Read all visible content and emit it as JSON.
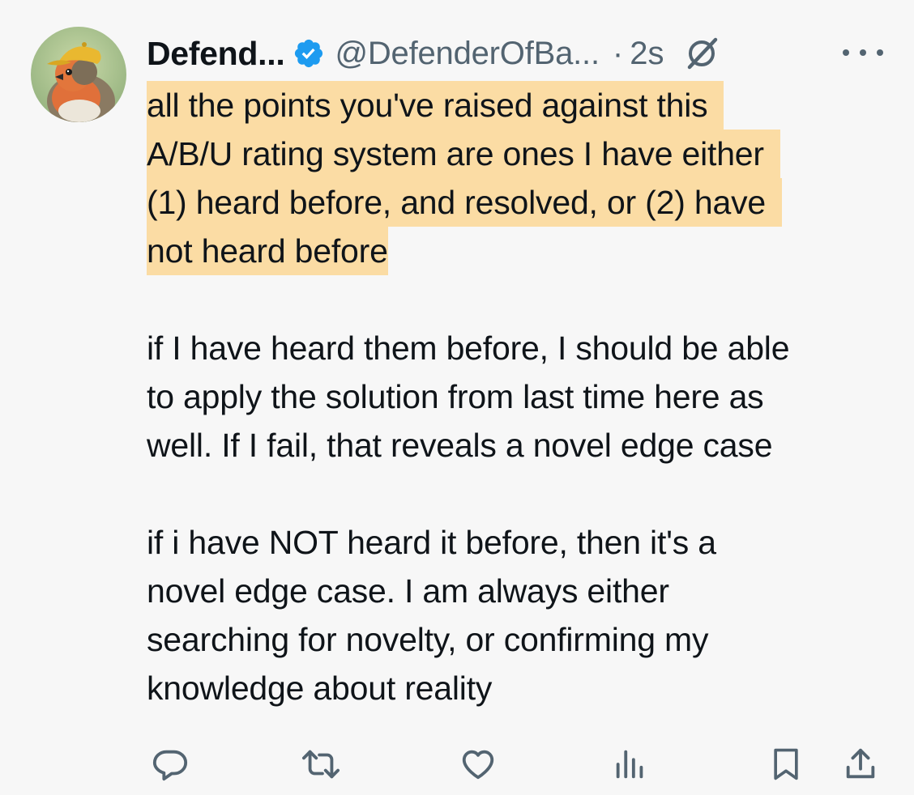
{
  "tweet": {
    "author": {
      "display_name": "Defend...",
      "handle": "@DefenderOfBa...",
      "verified": true,
      "avatar_icon": "avatar-robin-with-cap"
    },
    "separator": "·",
    "time": "2s",
    "header_icons": [
      "verified-badge-icon",
      "grok-icon",
      "more-icon"
    ],
    "body": {
      "highlighted_lines": [
        "all the points you've raised against this",
        "A/B/U rating system are ones I have either",
        "(1) heard before, and resolved, or (2) have",
        "not heard before"
      ],
      "paragraph2_lines": [
        "if I have heard them before, I should be able",
        "to apply the solution from last time here as",
        "well. If I fail, that reveals a novel edge case"
      ],
      "paragraph3_lines": [
        "if i have NOT heard it before, then it's a",
        "novel edge case. I am always either",
        "searching for novelty, or confirming my",
        "knowledge about reality"
      ]
    },
    "actions": [
      "reply-icon",
      "retweet-icon",
      "like-icon",
      "views-icon",
      "bookmark-icon",
      "share-icon"
    ]
  },
  "colors": {
    "background": "#f7f7f7",
    "text": "#0f1419",
    "secondary": "#536471",
    "highlight": "#fbdca4",
    "verified": "#1d9bf0"
  }
}
